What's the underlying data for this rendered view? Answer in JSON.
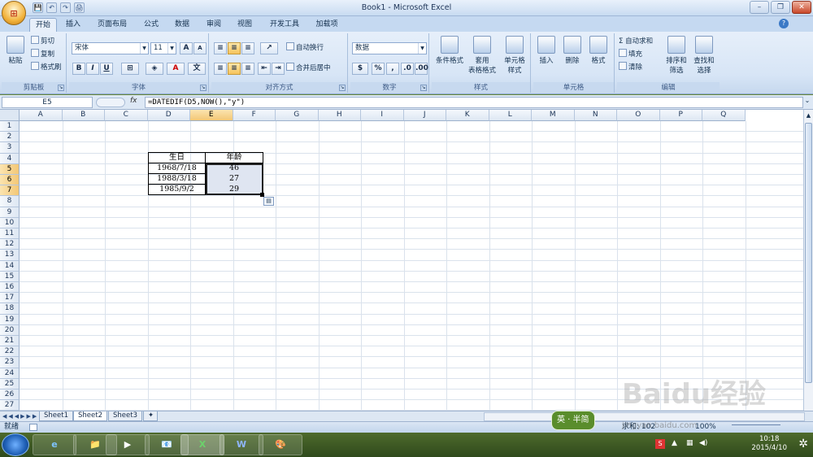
{
  "window": {
    "title": "Book1 - Microsoft Excel",
    "office_button_glyph": "⊞"
  },
  "qat": [
    "💾",
    "↶",
    "↷",
    "🖨"
  ],
  "ribbon_tabs": [
    "开始",
    "插入",
    "页面布局",
    "公式",
    "数据",
    "审阅",
    "视图",
    "开发工具",
    "加载项"
  ],
  "clipboard": {
    "paste": "粘贴",
    "cut": "剪切",
    "copy": "复制",
    "format_painter": "格式刷",
    "label": "剪贴板"
  },
  "font": {
    "name": "宋体",
    "size": "11",
    "label": "字体",
    "bold": "B",
    "italic": "I",
    "underline": "U",
    "grow": "A",
    "shrink": "A",
    "font_color": "A"
  },
  "alignment": {
    "wrap": "自动换行",
    "merge": "合并后居中",
    "label": "对齐方式"
  },
  "number": {
    "format": "数据",
    "percent": "%",
    "comma": ",",
    "label": "数字"
  },
  "styles": {
    "conditional": "条件格式",
    "table_format_1": "套用",
    "table_format_2": "表格格式",
    "cell_styles_1": "单元格",
    "cell_styles_2": "样式",
    "label": "样式"
  },
  "cells": {
    "insert": "插入",
    "delete": "删除",
    "format": "格式",
    "label": "单元格"
  },
  "editing": {
    "autosum": "Σ 自动求和",
    "fill": "填充",
    "clear": "清除",
    "sort_1": "排序和",
    "sort_2": "筛选",
    "find_1": "查找和",
    "find_2": "选择",
    "label": "编辑"
  },
  "formula_bar": {
    "name_box": "E5",
    "fx": "fx",
    "formula": "=DATEDIF(D5,NOW(),\"y\")"
  },
  "columns": [
    "A",
    "B",
    "C",
    "D",
    "E",
    "F",
    "G",
    "H",
    "I",
    "J",
    "K",
    "L",
    "M",
    "N",
    "O",
    "P",
    "Q"
  ],
  "rows": [
    "1",
    "2",
    "3",
    "4",
    "5",
    "6",
    "7",
    "8",
    "9",
    "10",
    "11",
    "12",
    "13",
    "14",
    "15",
    "16",
    "17",
    "18",
    "19",
    "20",
    "21",
    "22",
    "23",
    "24",
    "25",
    "26",
    "27",
    "28"
  ],
  "table": {
    "header_birth": "生日",
    "header_age": "年龄",
    "data": [
      {
        "birth": "1968/7/18",
        "age": "46"
      },
      {
        "birth": "1988/3/18",
        "age": "27"
      },
      {
        "birth": "1985/9/2",
        "age": "29"
      }
    ]
  },
  "sheets": [
    "Sheet1",
    "Sheet2",
    "Sheet3"
  ],
  "active_sheet": "Sheet2",
  "status": {
    "ready": "就绪",
    "count": "求和: 102",
    "zoom": "100%"
  },
  "taskbar": {
    "apps": [
      "e",
      "📁",
      "▶",
      "📧",
      "X",
      "W",
      "🎨"
    ],
    "time": "10:18",
    "date": "2015/4/10"
  },
  "watermark": {
    "text": "Baidu经验",
    "url": "jingyan.baidu.com",
    "badge": "英 · 半简"
  }
}
